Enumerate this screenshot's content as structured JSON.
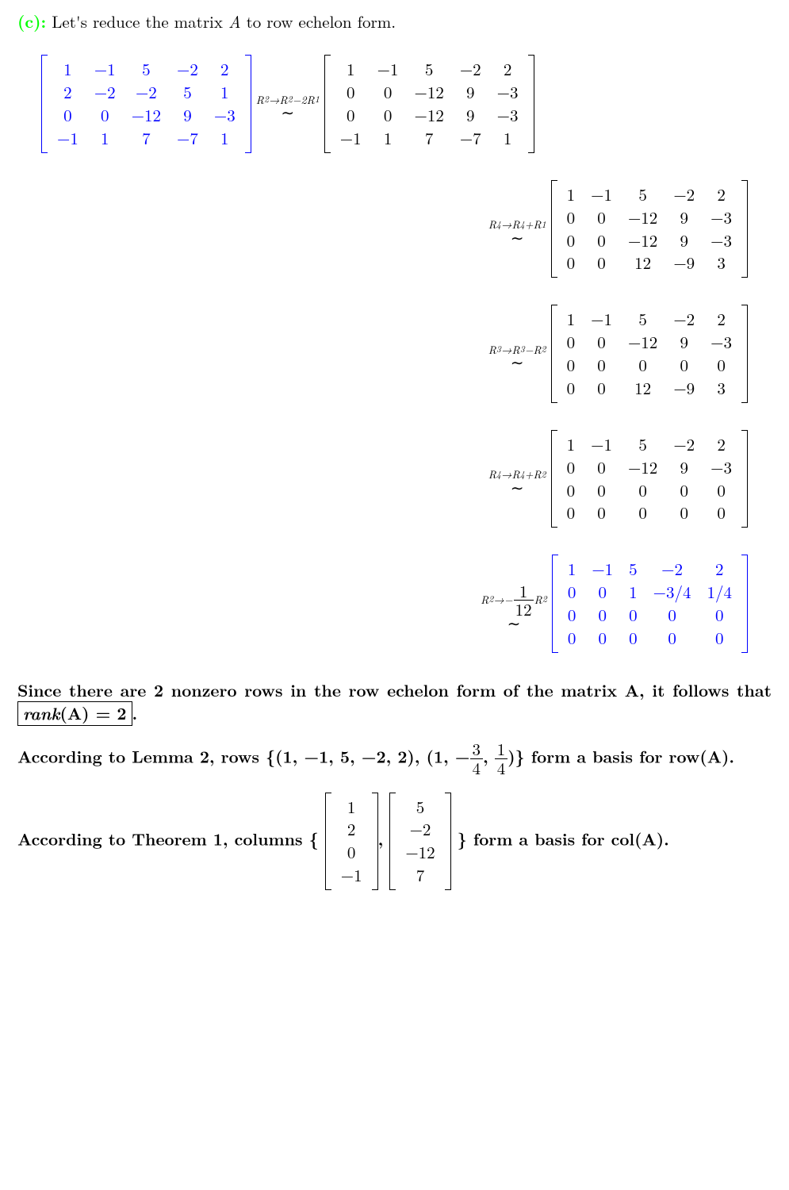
{
  "intro": {
    "label": "(c):",
    "text": "Let's reduce the matrix ",
    "var": "A",
    "text2": " to row echelon form."
  },
  "steps": [
    {
      "op_pre": "R",
      "op_s1": "2",
      "op_arrow": "→",
      "op_r": "R",
      "op_s2": "2",
      "op_mid": "−2",
      "op_r2": "R",
      "op_s3": "1",
      "M": [
        [
          "1",
          "−1",
          "5",
          "−2",
          "2"
        ],
        [
          "0",
          "0",
          "−12",
          "9",
          "−3"
        ],
        [
          "0",
          "0",
          "−12",
          "9",
          "−3"
        ],
        [
          "−1",
          "1",
          "7",
          "−7",
          "1"
        ]
      ]
    },
    {
      "op_pre": "R",
      "op_s1": "4",
      "op_arrow": "→",
      "op_r": "R",
      "op_s2": "4",
      "op_mid": "+",
      "op_r2": "R",
      "op_s3": "1",
      "M": [
        [
          "1",
          "−1",
          "5",
          "−2",
          "2"
        ],
        [
          "0",
          "0",
          "−12",
          "9",
          "−3"
        ],
        [
          "0",
          "0",
          "−12",
          "9",
          "−3"
        ],
        [
          "0",
          "0",
          "12",
          "−9",
          "3"
        ]
      ]
    },
    {
      "op_pre": "R",
      "op_s1": "3",
      "op_arrow": "→",
      "op_r": "R",
      "op_s2": "3",
      "op_mid": "−",
      "op_r2": "R",
      "op_s3": "2",
      "M": [
        [
          "1",
          "−1",
          "5",
          "−2",
          "2"
        ],
        [
          "0",
          "0",
          "−12",
          "9",
          "−3"
        ],
        [
          "0",
          "0",
          "0",
          "0",
          "0"
        ],
        [
          "0",
          "0",
          "12",
          "−9",
          "3"
        ]
      ]
    },
    {
      "op_pre": "R",
      "op_s1": "4",
      "op_arrow": "→",
      "op_r": "R",
      "op_s2": "4",
      "op_mid": "+",
      "op_r2": "R",
      "op_s3": "2",
      "M": [
        [
          "1",
          "−1",
          "5",
          "−2",
          "2"
        ],
        [
          "0",
          "0",
          "−12",
          "9",
          "−3"
        ],
        [
          "0",
          "0",
          "0",
          "0",
          "0"
        ],
        [
          "0",
          "0",
          "0",
          "0",
          "0"
        ]
      ]
    }
  ],
  "initial": [
    [
      "1",
      "−1",
      "5",
      "−2",
      "2"
    ],
    [
      "2",
      "−2",
      "−2",
      "5",
      "1"
    ],
    [
      "0",
      "0",
      "−12",
      "9",
      "−3"
    ],
    [
      "−1",
      "1",
      "7",
      "−7",
      "1"
    ]
  ],
  "finalop": {
    "pre": "R",
    "s1": "2",
    "arrow": "→−",
    "fracn": "1",
    "fracd": "12",
    "r": "R",
    "s2": "2"
  },
  "final": [
    [
      "1",
      "−1",
      "5",
      "−2",
      "2"
    ],
    [
      "0",
      "0",
      "1",
      "−3/4",
      "1/4"
    ],
    [
      "0",
      "0",
      "0",
      "0",
      "0"
    ],
    [
      "0",
      "0",
      "0",
      "0",
      "0"
    ]
  ],
  "conc1a": "Since there are 2 nonzero rows in the row echelon form of the matrix A, it follows that ",
  "conc1box_l": "rank",
  "conc1box_r": "(A) = 2",
  "conc2a": "According to Lemma 2, rows ",
  "conc2set": "{(1, −1, 5, −2, 2), (1, −",
  "conc2f1n": "3",
  "conc2f1d": "4",
  "conc2mid": ", ",
  "conc2f2n": "1",
  "conc2f2d": "4",
  "conc2end": ")}",
  "conc2b": " form a basis for row(A).",
  "conc3a": "According to Theorem 1, columns ",
  "col1": [
    "1",
    "2",
    "0",
    "−1"
  ],
  "col2": [
    "5",
    "−2",
    "−12",
    "7"
  ],
  "conc3b": " form a basis for col(A).",
  "bopen": "{",
  "bclose": "}",
  "comma": ", ",
  "period": "."
}
